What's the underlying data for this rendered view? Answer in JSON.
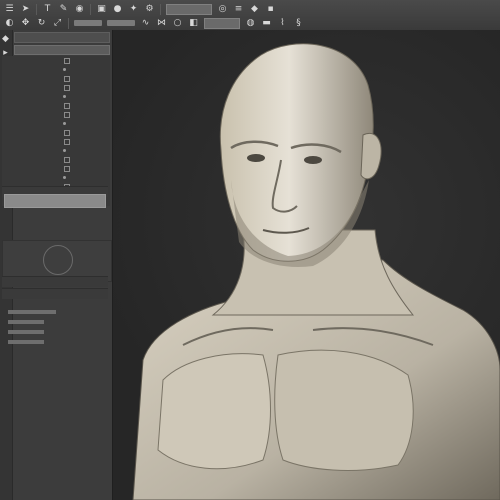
{
  "toolbar": {
    "row1_icons": [
      "menu-icon",
      "cursor-icon",
      "text-icon",
      "brush-icon",
      "camera-icon",
      "cube-icon",
      "sphere-icon",
      "light-icon",
      "settings-icon",
      "grid-icon",
      "eye-icon",
      "stack-icon",
      "paint-icon",
      "lock-icon"
    ],
    "row2_icons": [
      "sculpt-icon",
      "move-icon",
      "rotate-icon",
      "scale-icon",
      "smooth-icon",
      "pinch-icon",
      "inflate-icon",
      "mask-icon",
      "clay-icon",
      "flatten-icon",
      "crease-icon",
      "snake-icon"
    ]
  },
  "panel": {
    "title": "",
    "search_placeholder": "",
    "rows": [
      "",
      "",
      "",
      "",
      "",
      "",
      "",
      "",
      "",
      "",
      "",
      "",
      "",
      "",
      "",
      ""
    ]
  },
  "sections": {
    "preview_label": "",
    "sub_label": ""
  },
  "viewport": {
    "subject": "3D sculpted bust"
  }
}
